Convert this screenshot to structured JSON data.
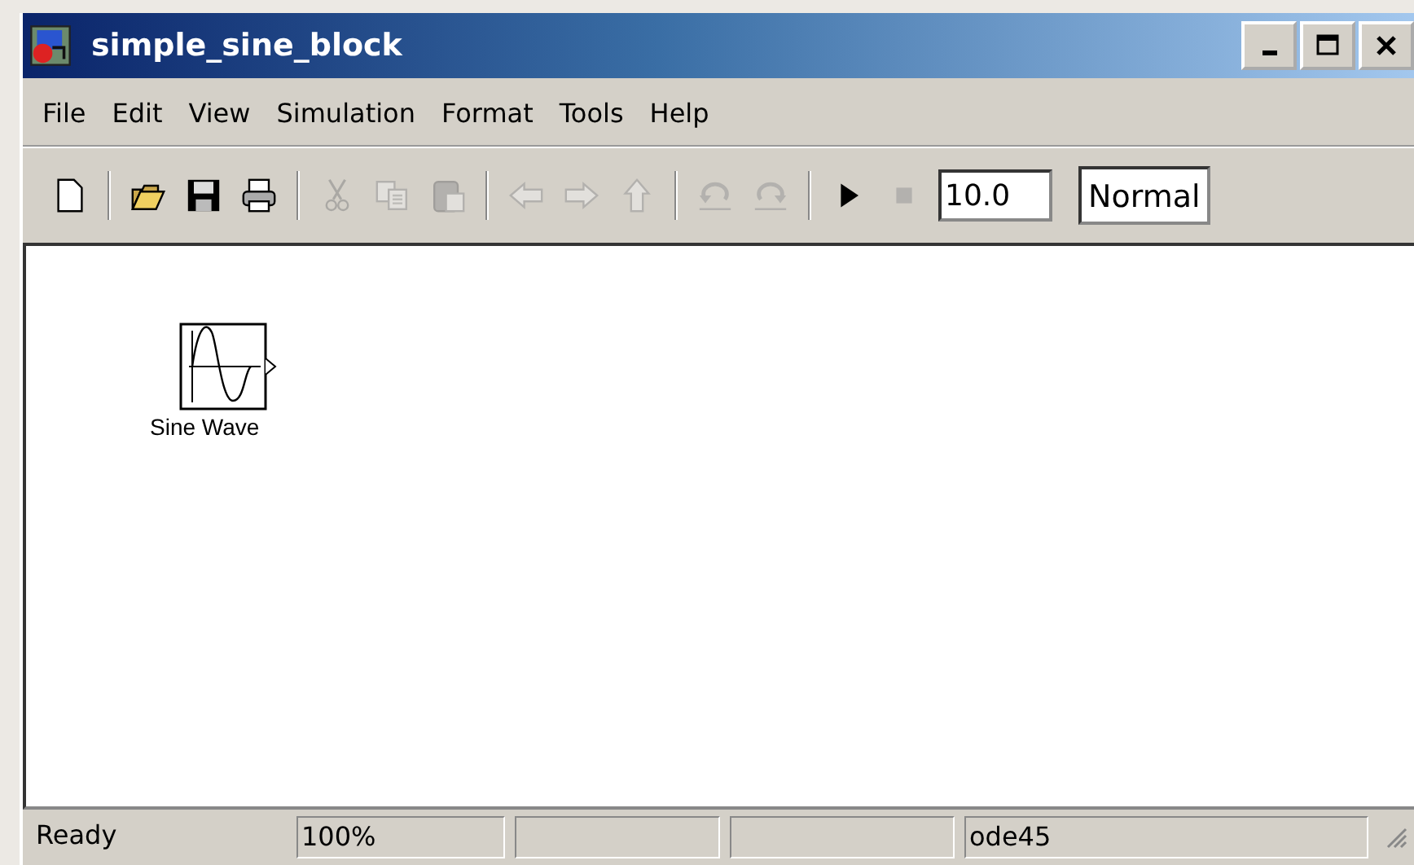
{
  "window": {
    "title": "simple_sine_block"
  },
  "menu": [
    {
      "label": "File"
    },
    {
      "label": "Edit"
    },
    {
      "label": "View"
    },
    {
      "label": "Simulation"
    },
    {
      "label": "Format"
    },
    {
      "label": "Tools"
    },
    {
      "label": "Help"
    }
  ],
  "toolbar": [
    {
      "kind": "new",
      "disabled": false
    },
    {
      "kind": "separator"
    },
    {
      "kind": "open",
      "disabled": false
    },
    {
      "kind": "save",
      "disabled": false
    },
    {
      "kind": "print",
      "disabled": false
    },
    {
      "kind": "separator"
    },
    {
      "kind": "cut",
      "disabled": true
    },
    {
      "kind": "copy",
      "disabled": true
    },
    {
      "kind": "paste",
      "disabled": true
    },
    {
      "kind": "separator"
    },
    {
      "kind": "back",
      "disabled": true
    },
    {
      "kind": "forward",
      "disabled": true
    },
    {
      "kind": "up",
      "disabled": true
    },
    {
      "kind": "separator"
    },
    {
      "kind": "undo",
      "disabled": true
    },
    {
      "kind": "redo",
      "disabled": true
    },
    {
      "kind": "separator"
    },
    {
      "kind": "play",
      "disabled": false
    },
    {
      "kind": "stop",
      "disabled": true
    }
  ],
  "stop_time": {
    "value": "10.0"
  },
  "sim_mode": {
    "value": "Normal"
  },
  "blocks": [
    {
      "label": "Sine Wave"
    }
  ],
  "status_bar": [
    {
      "kind": "text",
      "text": "Ready"
    },
    {
      "kind": "panel",
      "text": "100%"
    },
    {
      "kind": "panel"
    },
    {
      "kind": "panel"
    },
    {
      "kind": "panel",
      "text": "ode45"
    }
  ]
}
